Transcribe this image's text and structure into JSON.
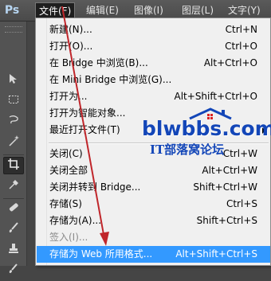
{
  "app": {
    "logo": "Ps"
  },
  "menubar": [
    {
      "label": "文件(F)",
      "active": true
    },
    {
      "label": "编辑(E)",
      "active": false
    },
    {
      "label": "图像(I)",
      "active": false
    },
    {
      "label": "图层(L)",
      "active": false
    },
    {
      "label": "文字(Y)",
      "active": false
    }
  ],
  "file_menu": {
    "items": [
      {
        "label": "新建(N)...",
        "shortcut": "Ctrl+N"
      },
      {
        "label": "打开(O)...",
        "shortcut": "Ctrl+O"
      },
      {
        "label": "在 Bridge 中浏览(B)...",
        "shortcut": "Alt+Ctrl+O"
      },
      {
        "label": "在 Mini Bridge 中浏览(G)...",
        "shortcut": ""
      },
      {
        "label": "打开为...",
        "shortcut": "Alt+Shift+Ctrl+O"
      },
      {
        "label": "打开为智能对象...",
        "shortcut": ""
      },
      {
        "label": "最近打开文件(T)",
        "shortcut": ""
      },
      {
        "label": "关闭(C)",
        "shortcut": "Ctrl+W"
      },
      {
        "label": "关闭全部",
        "shortcut": "Alt+Ctrl+W"
      },
      {
        "label": "关闭并转到 Bridge...",
        "shortcut": "Shift+Ctrl+W"
      },
      {
        "label": "存储(S)",
        "shortcut": "Ctrl+S"
      },
      {
        "label": "存储为(A)...",
        "shortcut": "Shift+Ctrl+S"
      },
      {
        "label": "签入(I)...",
        "shortcut": ""
      },
      {
        "label": "存储为 Web 所用格式...",
        "shortcut": "Alt+Shift+Ctrl+S"
      }
    ],
    "disabled_index": 12,
    "highlighted_index": 13,
    "submenu_index": 6
  },
  "watermark": {
    "brand": "blwbbs.com",
    "slogan": "IT部落窝论坛"
  },
  "colors": {
    "highlight": "#3399ff",
    "annotation_arrow": "#c0262b",
    "watermark": "#1346b8"
  },
  "tools": [
    "move-tool-icon",
    "marquee-tool-icon",
    "lasso-tool-icon",
    "magic-wand-icon",
    "crop-tool-icon",
    "eyedropper-icon",
    "healing-brush-icon",
    "brush-tool-icon",
    "clone-stamp-icon",
    "history-brush-icon",
    "eraser-icon"
  ]
}
